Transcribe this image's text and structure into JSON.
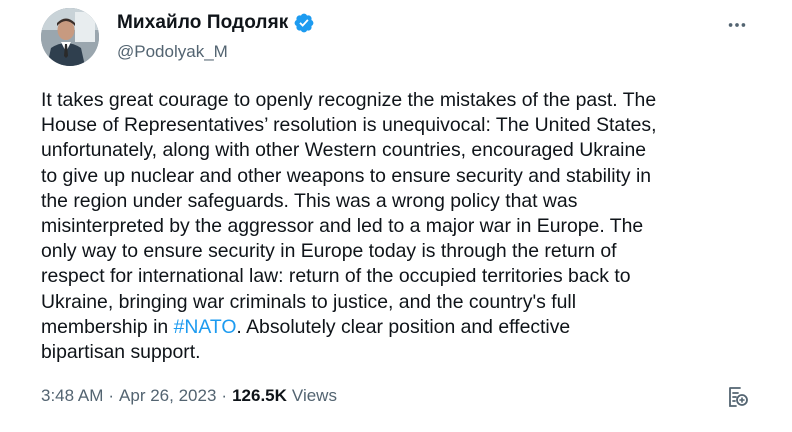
{
  "author": {
    "display_name": "Михайло Подоляк",
    "handle": "@Podolyak_M",
    "verified": true
  },
  "tweet": {
    "lines": [
      "It takes great courage to openly recognize the mistakes of the past. The",
      "House of Representatives’ resolution is unequivocal: The United States,",
      "unfortunately, along with other Western countries, encouraged Ukraine",
      "to give up nuclear and other weapons to ensure security and stability in",
      "the region under safeguards. This was a wrong policy that was",
      "misinterpreted by the aggressor and led to a major war in Europe. The",
      "only way to ensure security in Europe today is through the return of",
      "respect for international law: return of the occupied territories back to",
      "Ukraine, bringing war criminals to justice, and the country's full"
    ],
    "last_line_before": "membership in ",
    "hashtag": "#NATO",
    "last_line_after": ". Absolutely clear position and effective",
    "final_line": "bipartisan support."
  },
  "meta": {
    "time": "3:48 AM",
    "separator": "·",
    "date": "Apr 26, 2023",
    "views_count": "126.5K",
    "views_label": "Views"
  },
  "icons": {
    "more": "more-dots-icon",
    "verified": "verified-badge-icon",
    "notes": "community-notes-icon"
  },
  "colors": {
    "text": "#0f1419",
    "secondary": "#536471",
    "accent": "#1d9bf0"
  }
}
